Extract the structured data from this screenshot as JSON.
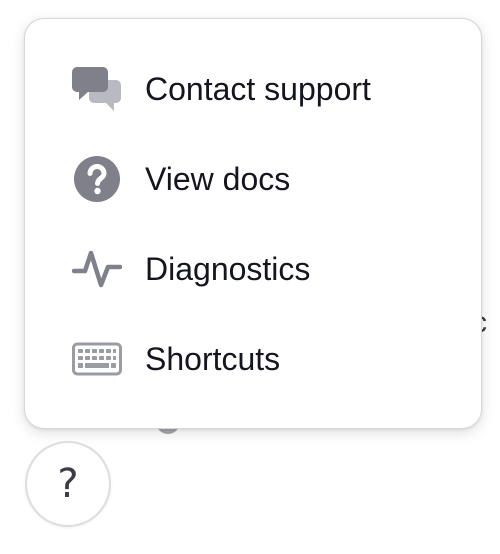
{
  "background": {
    "partial_text": "c"
  },
  "menu": {
    "items": [
      {
        "label": "Contact support",
        "icon": "chat-bubbles-icon"
      },
      {
        "label": "View docs",
        "icon": "question-circle-icon"
      },
      {
        "label": "Diagnostics",
        "icon": "activity-pulse-icon"
      },
      {
        "label": "Shortcuts",
        "icon": "keyboard-icon"
      }
    ]
  },
  "help_button": {
    "glyph": "?",
    "icon": "question-mark-icon"
  },
  "colors": {
    "icon_gray": "#8a8b94",
    "text": "#14151f",
    "border": "#d7d7db"
  }
}
